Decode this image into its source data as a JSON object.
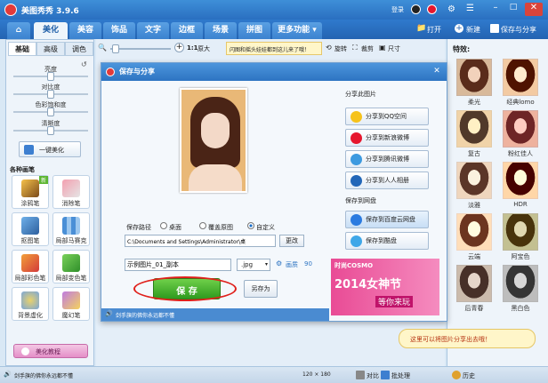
{
  "app": {
    "title": "美图秀秀 3.9.6",
    "login": "登录"
  },
  "tabs": [
    {
      "label": "美化"
    },
    {
      "label": "美容"
    },
    {
      "label": "饰品"
    },
    {
      "label": "文字"
    },
    {
      "label": "边框"
    },
    {
      "label": "场景"
    },
    {
      "label": "拼图"
    },
    {
      "label": "更多功能 ▾"
    }
  ],
  "home_icon": "home-icon",
  "topbar": {
    "open": "打开",
    "new": "新建",
    "save_share": "保存与分享"
  },
  "toolbar": {
    "zoom_label": "1:1",
    "original_label": "原大",
    "notice": "闪图和摇头娃娃都到这儿来了哦！",
    "rotate": "旋转",
    "crop": "裁剪",
    "resize": "尺寸"
  },
  "left_tabs": [
    {
      "label": "基础"
    },
    {
      "label": "高级"
    },
    {
      "label": "调色"
    }
  ],
  "adjust": {
    "brightness": "亮度",
    "contrast": "对比度",
    "saturation": "色彩饱和度",
    "sharpness": "清晰度",
    "brightness_value": 0.5,
    "contrast_value": 0.5,
    "saturation_value": 0.5,
    "sharpness_value": 0.5
  },
  "auto_beautify": "一键美化",
  "brushes": {
    "title": "各种画笔",
    "new_badge": "新",
    "items": [
      {
        "label": "涂鸦笔"
      },
      {
        "label": "消除笔"
      },
      {
        "label": "抠图笔"
      },
      {
        "label": "局部马赛克"
      },
      {
        "label": "局部彩色笔"
      },
      {
        "label": "局部变色笔"
      },
      {
        "label": "背景虚化"
      },
      {
        "label": "魔幻笔"
      }
    ]
  },
  "tutorial": "美化教程",
  "effects": {
    "title": "特效:",
    "items": [
      {
        "label": "柔光"
      },
      {
        "label": "经典lomo"
      },
      {
        "label": "复古"
      },
      {
        "label": "粉红佳人"
      },
      {
        "label": "淡雅"
      },
      {
        "label": "HDR"
      },
      {
        "label": "云端"
      },
      {
        "label": "阿宝色"
      },
      {
        "label": "后青春"
      },
      {
        "label": "黑白色"
      }
    ]
  },
  "dialog": {
    "title": "保存与分享",
    "share_title": "分享此图片",
    "share_buttons": [
      {
        "label": "分享到QQ空间"
      },
      {
        "label": "分享到新浪微博"
      },
      {
        "label": "分享到腾讯微博"
      },
      {
        "label": "分享到人人相册"
      }
    ],
    "cloud_title": "保存到网盘",
    "cloud_buttons": [
      {
        "label": "保存到百度云网盘"
      },
      {
        "label": "保存到酷盘"
      }
    ],
    "path_label": "保存路径",
    "path_options": [
      {
        "label": "桌面"
      },
      {
        "label": "覆盖原图"
      },
      {
        "label": "自定义"
      }
    ],
    "path_value": "C:\\Documents and Settings\\Administrator\\桌",
    "change": "更改",
    "filename": "示例图片_01_副本",
    "ext": ".jpg",
    "quality_label": "画质",
    "quality_value": "90",
    "save": "保 存",
    "save_as": "另存为",
    "tip": "剑手旗的佛你永远都不懂",
    "ad_brand": "时尚COSMO",
    "ad_year": "2014女神节",
    "ad_sub": "等你来玩"
  },
  "status": {
    "tip": "剑手旗的佛你永远都不懂",
    "dims": "120 × 180",
    "compare": "对比",
    "batch": "批处理",
    "history": "历史"
  },
  "bubble": "这里可以将图片分享出去哦！",
  "colors": {
    "accent": "#2d74c2",
    "save_green": "#3fae2a",
    "highlight_red": "#e0201b"
  }
}
